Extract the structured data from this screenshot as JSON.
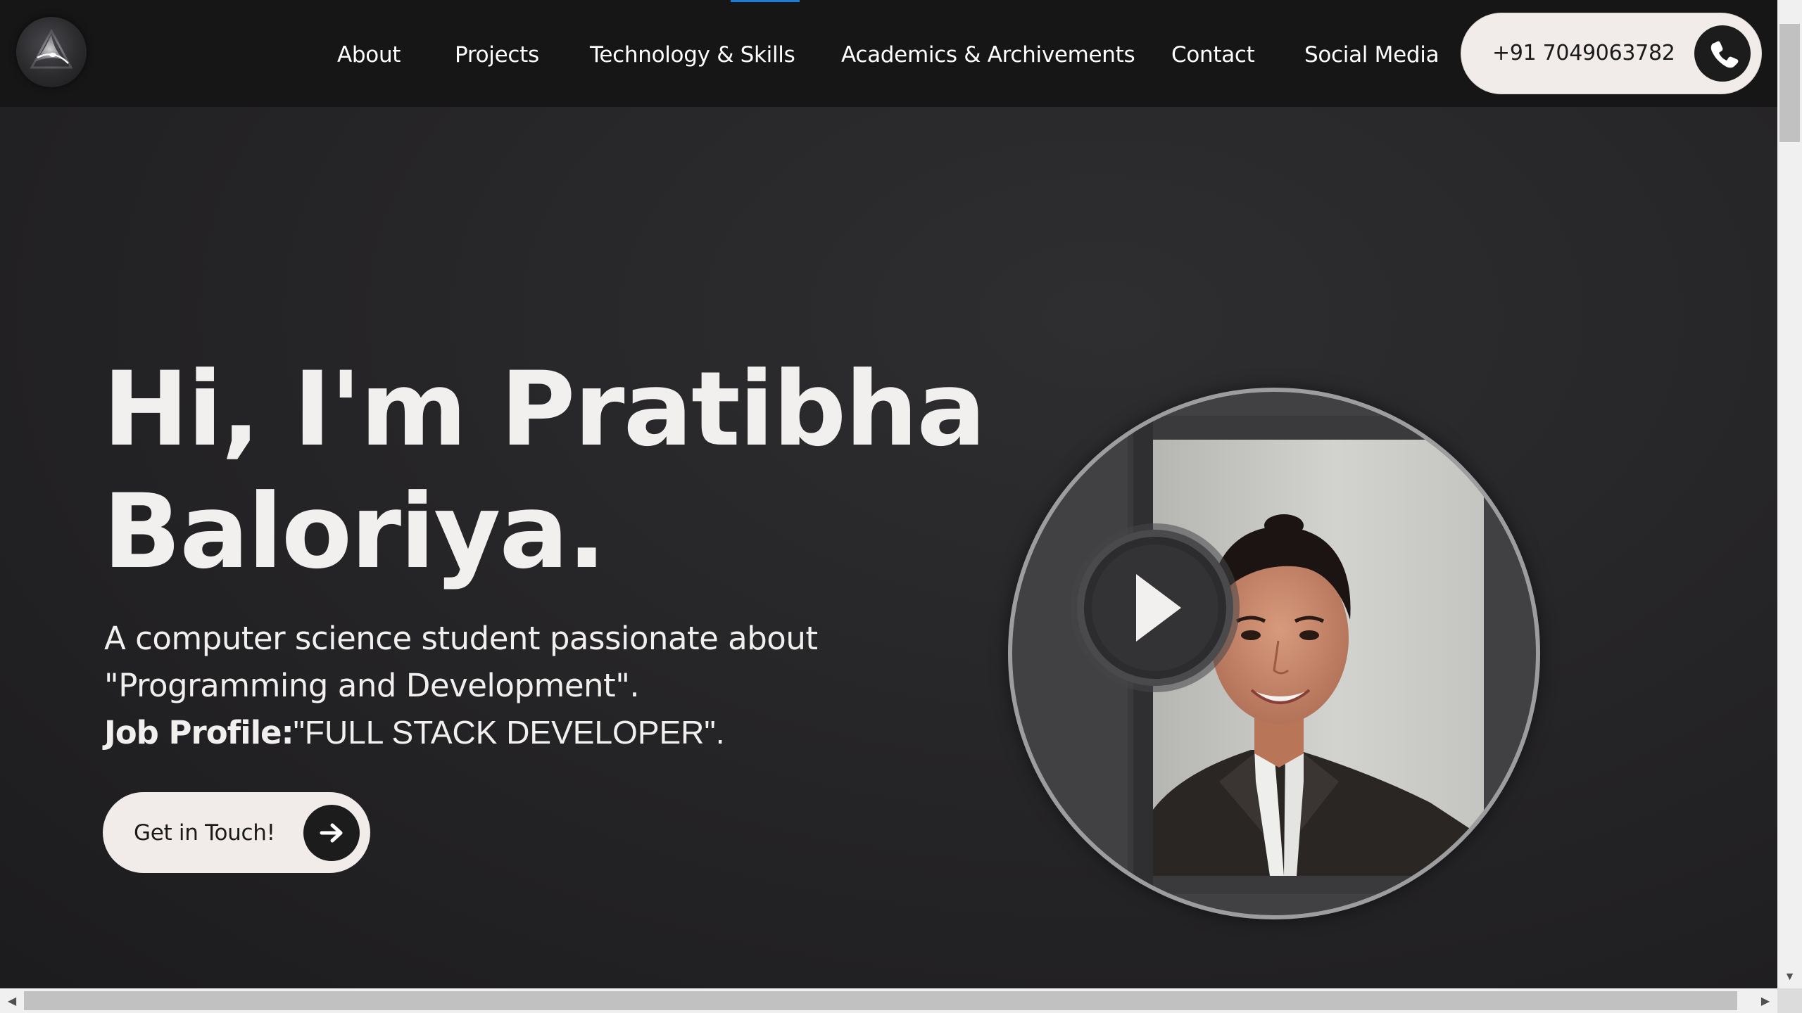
{
  "header": {
    "nav": [
      {
        "label": "About"
      },
      {
        "label": "Projects"
      },
      {
        "label": "Technology & Skills"
      },
      {
        "label": "Academics & Archivements"
      },
      {
        "label": "Contact"
      },
      {
        "label": "Social Media"
      }
    ],
    "phone": "+91 7049063782",
    "phone_icon": "phone-icon",
    "logo_icon": "logo-icon",
    "accent_color": "#1c7cd6"
  },
  "hero": {
    "title_line1": "Hi, I'm Pratibha",
    "title_line2": "Baloriya.",
    "desc_line1": "A computer science student passionate about",
    "desc_line2": "\"Programming and Development\".",
    "job_label": "Job Profile:",
    "job_value": "\"FULL STACK DEVELOPER\".",
    "cta_label": "Get in Touch!",
    "cta_icon": "arrow-right-icon",
    "video_icon": "play-icon"
  },
  "colors": {
    "background": "#262527",
    "text": "#f2f0ee",
    "pill": "#f1ecea",
    "dark_button": "#1c1c1c"
  }
}
